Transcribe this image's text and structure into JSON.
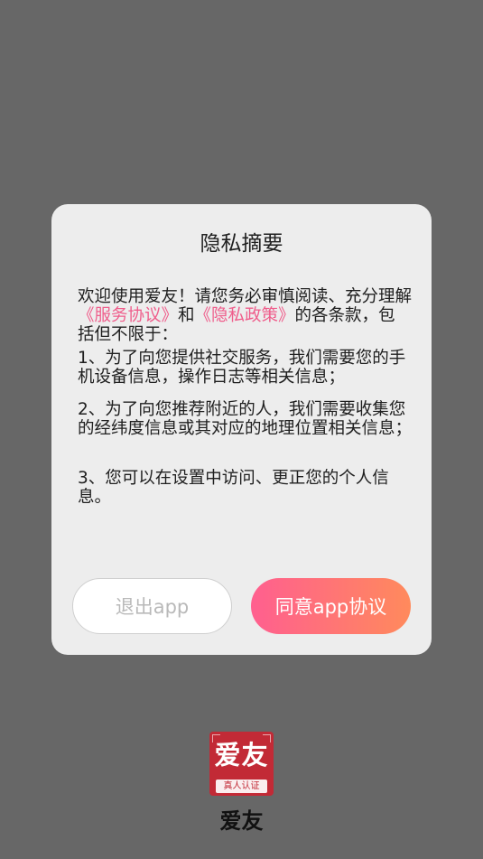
{
  "dialog": {
    "title": "隐私摘要",
    "paragraph1": {
      "before": "欢迎使用爱友！请您务必审慎阅读、充分理解",
      "link1": "《服务协议》",
      "middle": "和",
      "link2": "《隐私政策》",
      "after": "的各条款，包括但不限于："
    },
    "paragraph2": "1、为了向您提供社交服务，我们需要您的手机设备信息，操作日志等相关信息；",
    "paragraph3": "2、为了向您推荐附近的人，我们需要收集您的经纬度信息或其对应的地理位置相关信息；",
    "paragraph4": "3、您可以在设置中访问、更正您的个人信息。",
    "buttons": {
      "exit_label": "退出app",
      "agree_label": "同意app协议"
    }
  },
  "footer": {
    "logo_main": "爱友",
    "logo_sub": "真人认证",
    "app_name": "爱友"
  },
  "colors": {
    "overlay": "#676767",
    "dialog_bg": "#ededed",
    "link": "#ef5d8b",
    "agree_gradient_start": "#ff5f8f",
    "agree_gradient_end": "#ff8a5c",
    "logo_bg": "#c22a36"
  }
}
